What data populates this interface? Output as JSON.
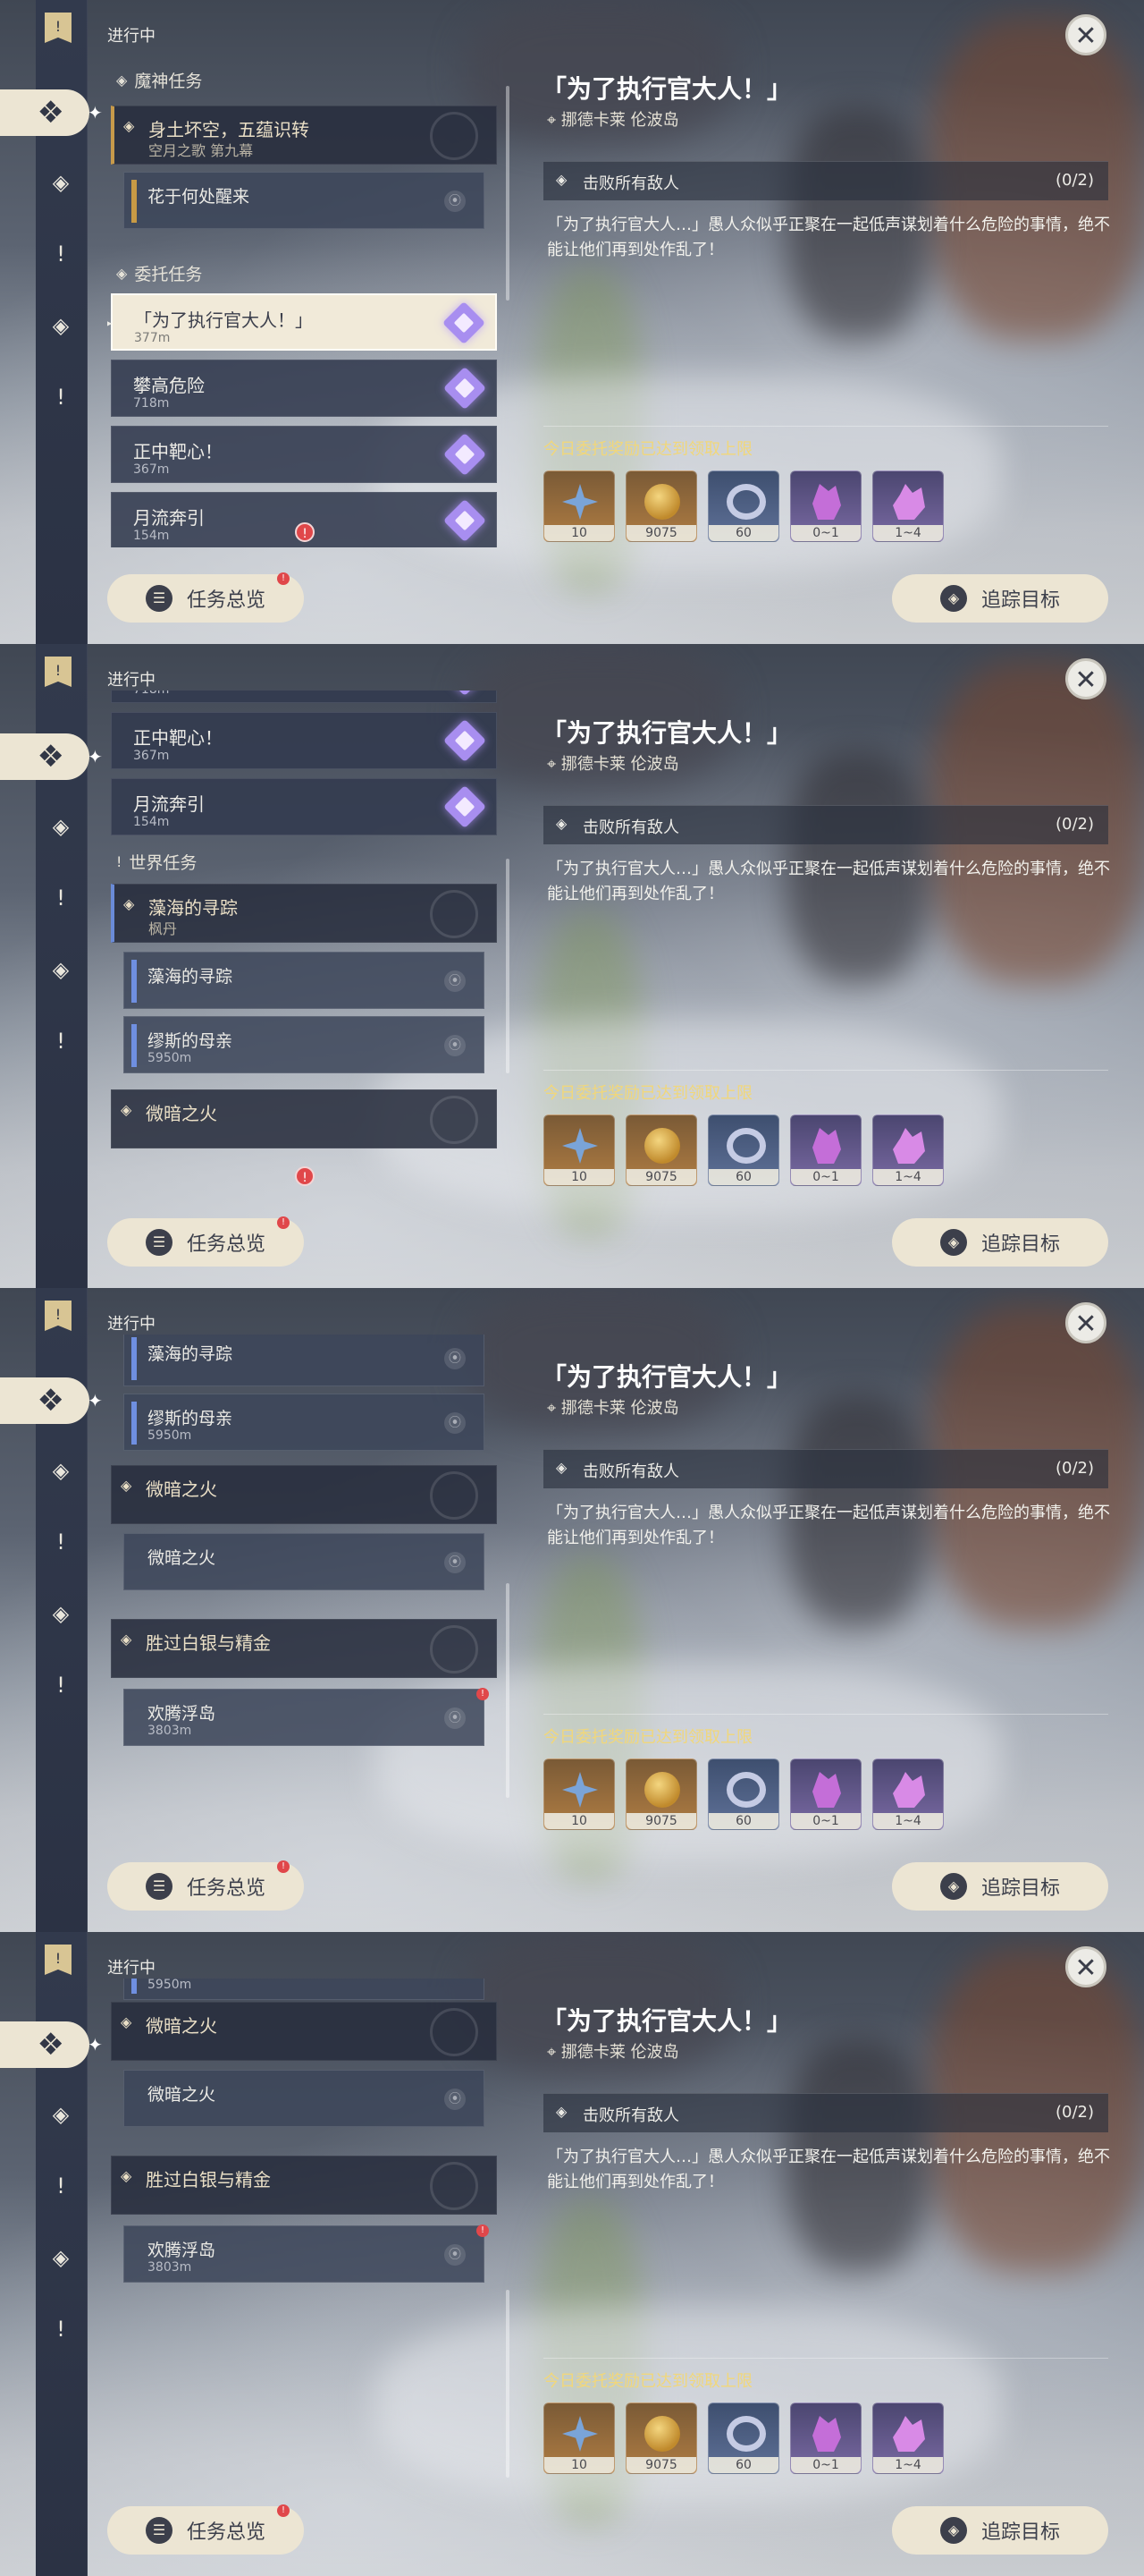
{
  "ui": {
    "ongoing": "进行中",
    "sections": {
      "archon": "魔神任务",
      "commission": "委托任务",
      "world": "世界任务"
    },
    "archon_group": {
      "title": "身土坏空，五蕴识转",
      "sub": "空月之歌 第九幕"
    },
    "archon_sub": "花于何处醒来",
    "commissions": [
      {
        "title": "「为了执行官大人！」",
        "dist": "377m"
      },
      {
        "title": "攀高危险",
        "dist": "718m"
      },
      {
        "title": "正中靶心！",
        "dist": "367m"
      },
      {
        "title": "月流奔引",
        "dist": "154m"
      }
    ],
    "world_group": {
      "title": "藻海的寻踪",
      "sub": "枫丹"
    },
    "world_subs": [
      {
        "title": "藻海的寻踪",
        "dist": ""
      },
      {
        "title": "缪斯的母亲",
        "dist": "5950m"
      }
    ],
    "group_fire": {
      "title": "微暗之火",
      "sub": "微暗之火"
    },
    "group_silver": {
      "title": "胜过白银与精金"
    },
    "silver_sub": {
      "title": "欢腾浮岛",
      "dist": "3803m"
    },
    "dist_5950": "5950m",
    "detail": {
      "title": "「为了执行官大人！」",
      "location": "挪德卡莱 伦波岛",
      "objective": "击败所有敌人",
      "progress": "(0/2)",
      "description": "「为了执行官大人…」愚人众似乎正聚在一起低声谋划着什么危险的事情，绝不能让他们再到处作乱了！",
      "reward_label": "今日委托奖励已达到领取上限",
      "rewards": [
        {
          "count": "10",
          "icon": "primogem-icon",
          "color": "#b07d43"
        },
        {
          "count": "9075",
          "icon": "mora-icon",
          "color": "#b07d43"
        },
        {
          "count": "60",
          "icon": "adventure-exp-icon",
          "color": "#5f7198"
        },
        {
          "count": "0~1",
          "icon": "crystal-icon",
          "color": "#7a6aa4"
        },
        {
          "count": "1~4",
          "icon": "crystal-icon",
          "color": "#7a6aa4"
        }
      ]
    },
    "buttons": {
      "overview": "任务总览",
      "track": "追踪目标"
    }
  }
}
